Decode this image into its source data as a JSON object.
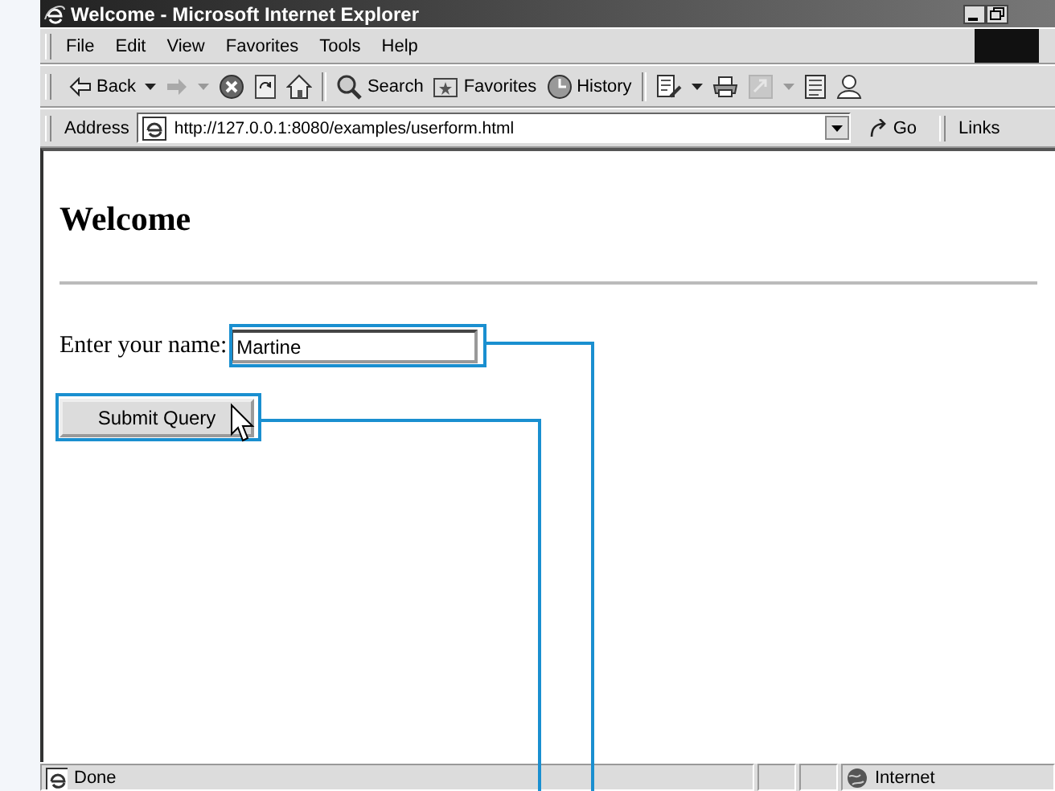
{
  "window": {
    "title": "Welcome - Microsoft Internet Explorer"
  },
  "menu": [
    {
      "label": "File"
    },
    {
      "label": "Edit"
    },
    {
      "label": "View"
    },
    {
      "label": "Favorites"
    },
    {
      "label": "Tools"
    },
    {
      "label": "Help"
    }
  ],
  "toolbar": [
    {
      "kind": "back",
      "label": "Back",
      "dropdown": true,
      "disabled": false
    },
    {
      "kind": "forward",
      "dropdown": true,
      "disabled": true
    },
    {
      "kind": "stop",
      "disabled": false
    },
    {
      "kind": "refresh",
      "disabled": false
    },
    {
      "kind": "home",
      "disabled": false
    },
    {
      "kind": "separator"
    },
    {
      "kind": "search",
      "label": "Search",
      "disabled": false
    },
    {
      "kind": "favorites",
      "label": "Favorites",
      "disabled": false
    },
    {
      "kind": "history",
      "label": "History",
      "disabled": false
    },
    {
      "kind": "separator"
    },
    {
      "kind": "mail",
      "dropdown": true,
      "disabled": false
    },
    {
      "kind": "print",
      "disabled": false
    },
    {
      "kind": "edit",
      "dropdown": true,
      "disabled": true
    },
    {
      "kind": "discuss",
      "disabled": false
    },
    {
      "kind": "messenger",
      "disabled": false
    }
  ],
  "address_bar": {
    "label": "Address",
    "value": "http://127.0.0.1:8080/examples/userform.html",
    "go": "Go",
    "links": "Links"
  },
  "page": {
    "heading": "Welcome",
    "field_label": "Enter your name:",
    "field_value": "Martine",
    "button": "Submit Query"
  },
  "status_bar": {
    "text": "Done",
    "zone": "Internet"
  }
}
